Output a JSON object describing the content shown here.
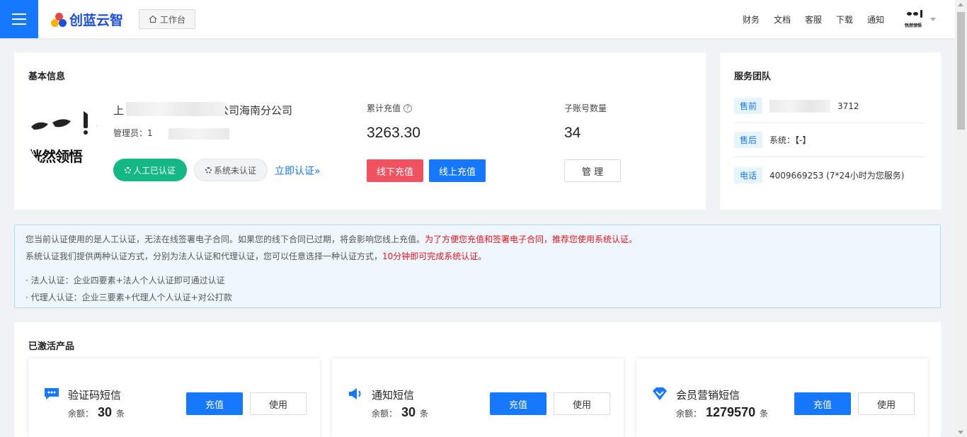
{
  "header": {
    "logo_text": "创蓝云智",
    "workbench_label": "工作台",
    "nav": [
      "财务",
      "文档",
      "客服",
      "下载",
      "通知"
    ],
    "avatar_caption": "恍然领悟"
  },
  "basic": {
    "title": "基本信息",
    "avatar_caption": "恍然领悟",
    "company_prefix": "上",
    "company_suffix": "限公司海南分公司",
    "admin_label": "管理员：",
    "admin_value_visible": "1",
    "tag_manual": "人工已认证",
    "tag_system": "系统未认证",
    "verify_link": "立即认证»",
    "recharge_label": "累计充值",
    "recharge_value": "3263.30",
    "sub_accounts_label": "子账号数量",
    "sub_accounts_value": "34",
    "offline_recharge": "线下充值",
    "online_recharge": "线上充值",
    "manage": "管 理"
  },
  "service": {
    "title": "服务团队",
    "rows": [
      {
        "tag": "售前",
        "value": "3712"
      },
      {
        "tag": "售后",
        "value": "系统：【-】"
      },
      {
        "tag": "电话",
        "value": "4009669253  (7*24小时为您服务)"
      }
    ]
  },
  "notice": {
    "line1_normal": "您当前认证使用的是人工认证，无法在线签署电子合同。如果您的线下合同已过期，将会影响您线上充值。",
    "line1_red": "为了方便您充值和签署电子合同，推荐您使用系统认证。",
    "line2_normal": "系统认证我们提供两种认证方式，分别为法人认证和代理认证，您可以任意选择一种认证方式，",
    "line2_red": "10分钟即可完成系统认证。",
    "line3": "· 法人认证：企业四要素+法人个人认证即可通过认证",
    "line4": "· 代理人认证：企业三要素+代理人个人认证+对公打款"
  },
  "products": {
    "title": "已激活产品",
    "items": [
      {
        "name": "验证码短信",
        "balance_label": "余额：",
        "balance": "30",
        "unit": "条",
        "recharge": "充值",
        "use": "使用",
        "icon": "chat-bubble-icon"
      },
      {
        "name": "通知短信",
        "balance_label": "余额：",
        "balance": "30",
        "unit": "条",
        "recharge": "充值",
        "use": "使用",
        "icon": "megaphone-icon"
      },
      {
        "name": "会员营销短信",
        "balance_label": "余额：",
        "balance": "1279570",
        "unit": "条",
        "recharge": "充值",
        "use": "使用",
        "icon": "diamond-icon"
      }
    ]
  },
  "colors": {
    "primary": "#1677ff",
    "green": "#13b885",
    "red": "#f0525f",
    "notice_bg": "#eef7fd"
  }
}
